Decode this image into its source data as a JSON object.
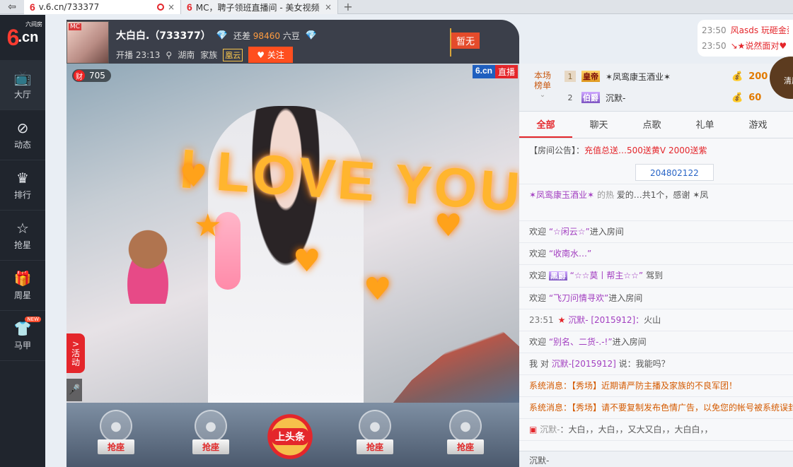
{
  "browser": {
    "back_icon": "back-arrow-icon",
    "tabs": [
      {
        "url": "v.6.cn/733377",
        "close": "×"
      },
      {
        "title": "MC，聘子领班直播间 - 美女视频",
        "close": "×"
      }
    ],
    "new_tab": "+"
  },
  "sidebar": {
    "logo_big": "6",
    "logo_cn": ".cn",
    "logo_tag": "六间房",
    "items": [
      {
        "label": "大厅",
        "icon": "tv-icon",
        "glyph": "📺"
      },
      {
        "label": "动态",
        "icon": "compass-icon",
        "glyph": "⊘"
      },
      {
        "label": "排行",
        "icon": "crown-icon",
        "glyph": "♛"
      },
      {
        "label": "抢星",
        "icon": "star-icon",
        "glyph": "☆"
      },
      {
        "label": "周星",
        "icon": "gift-icon",
        "glyph": "🎁"
      },
      {
        "label": "马甲",
        "icon": "shirt-icon",
        "glyph": "👕",
        "badge": "NEW"
      }
    ]
  },
  "anchor": {
    "mc_tag": "MC",
    "name": "大白白.（733377）",
    "diff_prefix": "还差",
    "diff_value": "98460",
    "diff_unit": "六豆",
    "start_label": "开播 23:13",
    "location": "湖南",
    "family_label": "家族",
    "family_tag": "凰云",
    "follow_label": "关注",
    "flag": "暂无"
  },
  "video": {
    "fortune_icon": "财",
    "fortune_value": "705",
    "live_logo": "6.cn",
    "live_label": "直播",
    "overlay_text": "I LOVE YOU",
    "activity_label": "活动",
    "activity_arrow": ">"
  },
  "seats": {
    "seat_label": "抢座",
    "headline": "上头条"
  },
  "top_messages": [
    {
      "time": "23:50",
      "text": "风asds 玩砸金蛋"
    },
    {
      "time": "23:50",
      "text": "↘★说然面对♥"
    }
  ],
  "clear_label": "清屏",
  "rank": {
    "label_line1": "本场",
    "label_line2": "榜单",
    "rows": [
      {
        "num": "1",
        "title": "皇帝",
        "name": "✶凤鸾康玉酒业✶",
        "value": "200"
      },
      {
        "num": "2",
        "title": "伯爵",
        "name": "沉默-",
        "value": "60"
      }
    ]
  },
  "tabs": [
    "全部",
    "聊天",
    "点歌",
    "礼单",
    "游戏"
  ],
  "chat": {
    "notice_label": "【房间公告】：",
    "notice_text": "充值总送…500送黄V 2000送紫",
    "room_id": "204802122",
    "lines": [
      {
        "a": "✶凤鸾康玉酒业✶",
        "b": "的热",
        "c": "爱的…共1个，感谢 ✶凤"
      },
      {
        "prefix": "欢迎 ",
        "name": "“☆闲云☆”",
        "suffix": "进入房间"
      },
      {
        "prefix": "欢迎 ",
        "name": "“收南水…”",
        "suffix": ""
      },
      {
        "prefix": "欢迎 ",
        "badge": "黑爵",
        "name": "“☆☆莫丨帮主☆☆”",
        "suffix": "驾到"
      },
      {
        "prefix": "欢迎 ",
        "name": "“飞刀问情寻欢”",
        "suffix": "进入房间"
      },
      {
        "time": "23:51",
        "name": "沉默-",
        "mid": "[2015912]：",
        "suffix": "火山"
      },
      {
        "prefix": "欢迎 ",
        "name": "“别名、二货-.-!”",
        "suffix": "进入房间"
      },
      {
        "prefix": "我 对 ",
        "name": "沉默-[2015912]",
        "suffix": " 说：我能吗？"
      },
      {
        "sys": "系统消息：【秀场】近期请严防主播及家族的不良军团！"
      },
      {
        "sys": "系统消息：【秀场】请不要复制发布色情广告，以免您的帐号被系统误封"
      },
      {
        "name": "沉默-",
        "suffix": "：大白，，大白，，又大又白，，大白白，，"
      }
    ]
  },
  "input_label": "沉默-"
}
